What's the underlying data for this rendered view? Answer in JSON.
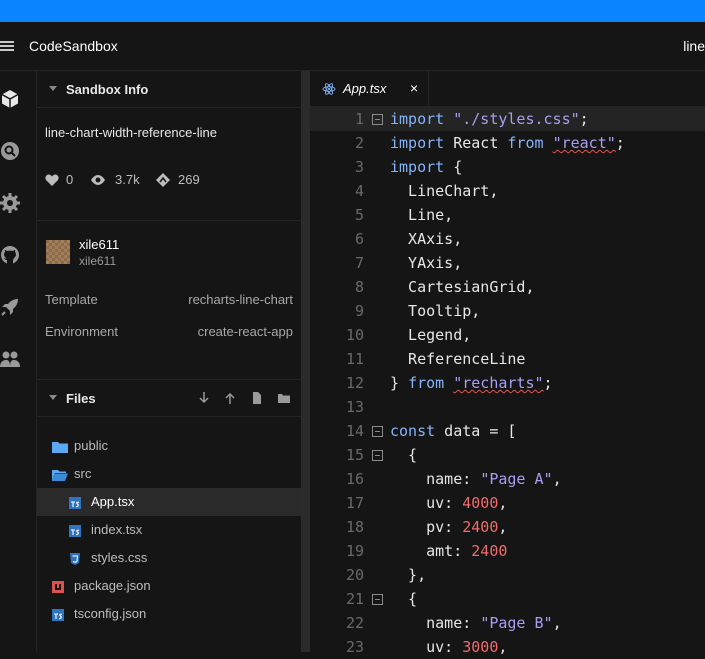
{
  "header": {
    "app_name": "CodeSandbox",
    "right_text": "line"
  },
  "activity_bar": [
    "box-icon",
    "search-icon",
    "gear-icon",
    "github-icon",
    "rocket-icon",
    "users-icon"
  ],
  "sidebar": {
    "info_title": "Sandbox Info",
    "sandbox_name": "line-chart-width-reference-line",
    "stats": {
      "likes": "0",
      "views": "3.7k",
      "forks": "269"
    },
    "user": {
      "name": "xile611",
      "handle": "xile611"
    },
    "template_label": "Template",
    "template_value": "recharts-line-chart",
    "environment_label": "Environment",
    "environment_value": "create-react-app",
    "files_title": "Files",
    "files": [
      {
        "name": "public",
        "type": "folder",
        "indent": 0
      },
      {
        "name": "src",
        "type": "folder-open",
        "indent": 0
      },
      {
        "name": "App.tsx",
        "type": "ts",
        "indent": 1,
        "selected": true
      },
      {
        "name": "index.tsx",
        "type": "ts",
        "indent": 1
      },
      {
        "name": "styles.css",
        "type": "css",
        "indent": 1
      },
      {
        "name": "package.json",
        "type": "json",
        "indent": 0
      },
      {
        "name": "tsconfig.json",
        "type": "ts",
        "indent": 0
      }
    ]
  },
  "editor": {
    "tab_label": "App.tsx",
    "close_glyph": "×",
    "lines": [
      {
        "n": "1",
        "fold": true,
        "active": true,
        "parts": [
          [
            "kw",
            "import"
          ],
          [
            "",
            " "
          ],
          [
            "str",
            "\"./styles.css\""
          ],
          [
            "",
            ";"
          ]
        ]
      },
      {
        "n": "2",
        "parts": [
          [
            "kw",
            "import"
          ],
          [
            "",
            " React "
          ],
          [
            "kw",
            "from"
          ],
          [
            "",
            " "
          ],
          [
            "str squig",
            "\"react\""
          ],
          [
            "",
            ";"
          ]
        ]
      },
      {
        "n": "3",
        "parts": [
          [
            "kw",
            "import"
          ],
          [
            "",
            " {"
          ]
        ]
      },
      {
        "n": "4",
        "parts": [
          [
            "",
            "  LineChart,"
          ]
        ]
      },
      {
        "n": "5",
        "parts": [
          [
            "",
            "  Line,"
          ]
        ]
      },
      {
        "n": "6",
        "parts": [
          [
            "",
            "  XAxis,"
          ]
        ]
      },
      {
        "n": "7",
        "parts": [
          [
            "",
            "  YAxis,"
          ]
        ]
      },
      {
        "n": "8",
        "parts": [
          [
            "",
            "  CartesianGrid,"
          ]
        ]
      },
      {
        "n": "9",
        "parts": [
          [
            "",
            "  Tooltip,"
          ]
        ]
      },
      {
        "n": "10",
        "parts": [
          [
            "",
            "  Legend,"
          ]
        ]
      },
      {
        "n": "11",
        "parts": [
          [
            "",
            "  ReferenceLine"
          ]
        ]
      },
      {
        "n": "12",
        "parts": [
          [
            "",
            "} "
          ],
          [
            "kw",
            "from"
          ],
          [
            "",
            " "
          ],
          [
            "str squig",
            "\"recharts\""
          ],
          [
            "",
            ";"
          ]
        ]
      },
      {
        "n": "13",
        "parts": []
      },
      {
        "n": "14",
        "fold": true,
        "parts": [
          [
            "kw",
            "const"
          ],
          [
            "",
            " data = ["
          ]
        ]
      },
      {
        "n": "15",
        "fold": true,
        "parts": [
          [
            "",
            "  {"
          ]
        ]
      },
      {
        "n": "16",
        "parts": [
          [
            "",
            "    name: "
          ],
          [
            "str",
            "\"Page A\""
          ],
          [
            "",
            ","
          ]
        ]
      },
      {
        "n": "17",
        "parts": [
          [
            "",
            "    uv: "
          ],
          [
            "num",
            "4000"
          ],
          [
            "",
            ","
          ]
        ]
      },
      {
        "n": "18",
        "parts": [
          [
            "",
            "    pv: "
          ],
          [
            "num",
            "2400"
          ],
          [
            "",
            ","
          ]
        ]
      },
      {
        "n": "19",
        "parts": [
          [
            "",
            "    amt: "
          ],
          [
            "num",
            "2400"
          ]
        ]
      },
      {
        "n": "20",
        "parts": [
          [
            "",
            "  },"
          ]
        ]
      },
      {
        "n": "21",
        "fold": true,
        "parts": [
          [
            "",
            "  {"
          ]
        ]
      },
      {
        "n": "22",
        "parts": [
          [
            "",
            "    name: "
          ],
          [
            "str",
            "\"Page B\""
          ],
          [
            "",
            ","
          ]
        ]
      },
      {
        "n": "23",
        "parts": [
          [
            "",
            "    uv: "
          ],
          [
            "num",
            "3000"
          ],
          [
            "",
            ","
          ]
        ]
      }
    ]
  }
}
